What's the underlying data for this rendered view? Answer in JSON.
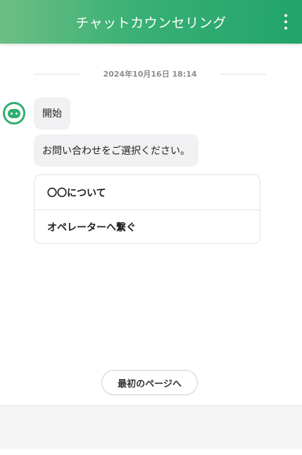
{
  "header": {
    "title": "チャットカウンセリング",
    "menu_icon": "more-vertical-icon",
    "background": "#2fae70"
  },
  "chat": {
    "date": "2024年10月16日 18:14",
    "avatar_icon": "bot-icon",
    "messages": [
      {
        "text": "開始"
      },
      {
        "text": "お問い合わせをご選択ください。"
      }
    ],
    "options": [
      {
        "label": "〇〇について"
      },
      {
        "label": "オペレーターへ繋ぐ"
      }
    ]
  },
  "actions": {
    "first_page_label": "最初のページへ"
  }
}
